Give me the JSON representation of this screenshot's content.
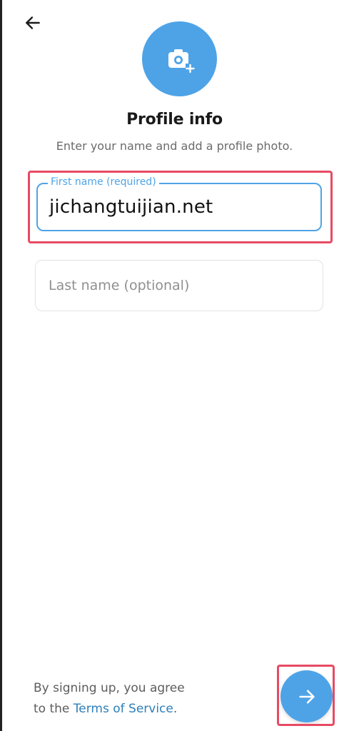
{
  "header": {
    "back_icon": "arrow-left-icon",
    "avatar_icon": "camera-add-icon"
  },
  "profile": {
    "title": "Profile info",
    "subtitle": "Enter your name and add a profile photo."
  },
  "form": {
    "first_name": {
      "label": "First name (required)",
      "value": "jichangtuijian.net"
    },
    "last_name": {
      "placeholder": "Last name (optional)",
      "value": ""
    }
  },
  "footer": {
    "legal_line1": "By signing up, you agree",
    "legal_prefix": "to the ",
    "terms_link": "Terms of Service",
    "legal_suffix": ".",
    "next_icon": "arrow-right-icon"
  },
  "colors": {
    "accent": "#4ea3e7",
    "highlight": "#e74a63",
    "link": "#2d7fb8"
  }
}
